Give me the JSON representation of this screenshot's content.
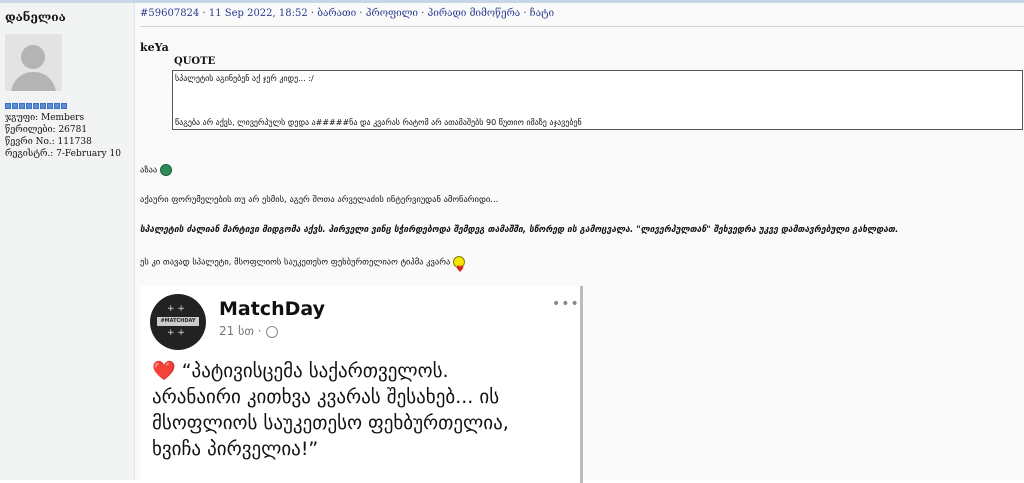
{
  "author": {
    "name": "დანელია",
    "rank_pips": 9,
    "group": "ჯგუფი: Members",
    "posts": "წერილები: 26781",
    "member_no": "წევრი No.: 111738",
    "registered": "რეგისტრ.: 7-February 10"
  },
  "post_header": {
    "post_id": "#59607824",
    "date": "11 Sep 2022, 18:52",
    "links": [
      "ბარათი",
      "პროფილი",
      "პირადი მიმოწერა",
      "ჩატი"
    ]
  },
  "quote": {
    "author": "keYa",
    "label": "QUOTE",
    "line1": "სპალეტის აგინებენ აქ ჯერ კიდე... :/",
    "line2": "წაგება არ აქვს, ლივერპულს დედა ა#####ნა და კვარას რატომ არ ათამაშებს 90 წუთიო იმაზე აჯავებენ"
  },
  "body": {
    "p1": "აზაა",
    "p2": "აქაური ფორუმელების თუ არ ესმის, აგერ შოთა არველაძის ინტერვიუდან ამონარიდი...",
    "p3": "სპალეტის ძალიან მარტივი მიდგომა აქვს. პირველი ვინც სჭირდებოდა შემდეგ თამაშში, სწორედ ის გამოცვალა. \"ლივერპულთან\" შეხვედრა უკვე დამთავრებული გახლდათ.",
    "p4": "ეს კი თავად სპალეტი, მსოფლიოს საუკეთესო ფეხბურთელიაო ტიპმა კვარა"
  },
  "embed": {
    "page_name": "MatchDay",
    "logo_text": "#MATCHDAY",
    "time": "21 სთ ·",
    "text_lines": [
      "❤️ “პატივისცემა საქართველოს.",
      "არანაირი კითხვა კვარას შესახებ... ის",
      "მსოფლიოს საუკეთესო ფეხბურთელია,",
      "ხვიჩა პირველია!”"
    ],
    "more": "•••"
  },
  "colors": {
    "link": "#2a3b8f",
    "sidebar_bg": "#f2f3f3",
    "pip": "#5b8fd6"
  }
}
